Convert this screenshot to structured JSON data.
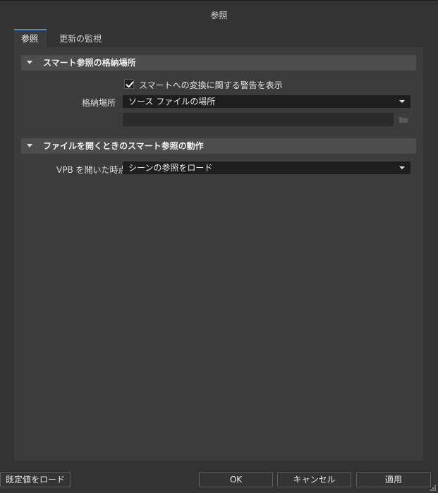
{
  "window": {
    "title": "参照"
  },
  "tabs": [
    {
      "label": "参照",
      "active": true
    },
    {
      "label": "更新の監視",
      "active": false
    }
  ],
  "sections": {
    "storage": {
      "title": "スマート参照の格納場所",
      "warning_checkbox": {
        "label": "スマートへの変換に関する警告を表示",
        "checked": true
      },
      "location": {
        "label": "格納場所",
        "value": "ソース ファイルの場所"
      },
      "path_value": ""
    },
    "open_behavior": {
      "title": "ファイルを開くときのスマート参照の動作",
      "vpb_open": {
        "label": "VPB を開いた時点",
        "value": "シーンの参照をロード"
      }
    }
  },
  "footer": {
    "load_defaults": "既定値をロード",
    "ok": "OK",
    "cancel": "キャンセル",
    "apply": "適用"
  },
  "colors": {
    "accent": "#4a8ad4",
    "background": "#333333",
    "panel": "#3c3c3c",
    "section_header": "#4d4d4d",
    "input": "#1e1e1e"
  },
  "icons": [
    "caret-down-icon",
    "checkmark-icon",
    "dropdown-arrow-icon",
    "folder-icon",
    "resize-grip-icon"
  ]
}
